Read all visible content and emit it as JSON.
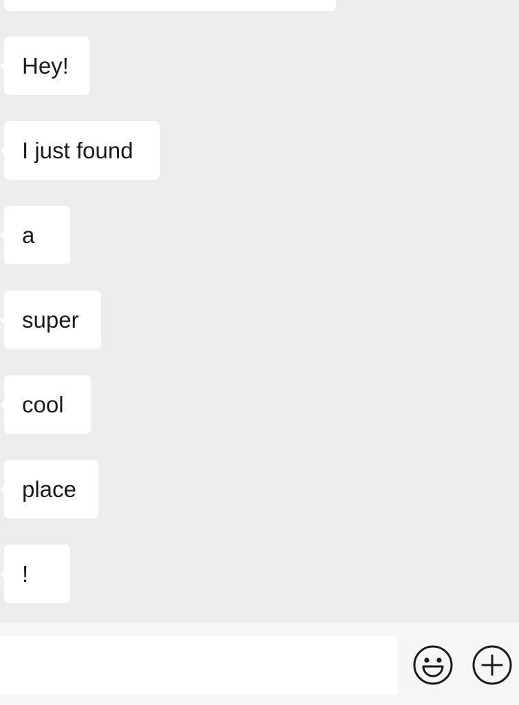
{
  "messages": [
    {
      "text": "Hey!"
    },
    {
      "text": "I just found"
    },
    {
      "text": "a"
    },
    {
      "text": "super"
    },
    {
      "text": "cool"
    },
    {
      "text": "place"
    },
    {
      "text": "!"
    }
  ],
  "input_bar": {
    "text_value": "",
    "emoji_icon": "smiley-face-icon",
    "more_icon": "plus-circle-icon"
  },
  "colors": {
    "background": "#ededed",
    "bubble": "#ffffff",
    "input_bar": "#f6f6f6",
    "text": "#1a1a1a",
    "icon_stroke": "#1a1a1a"
  }
}
